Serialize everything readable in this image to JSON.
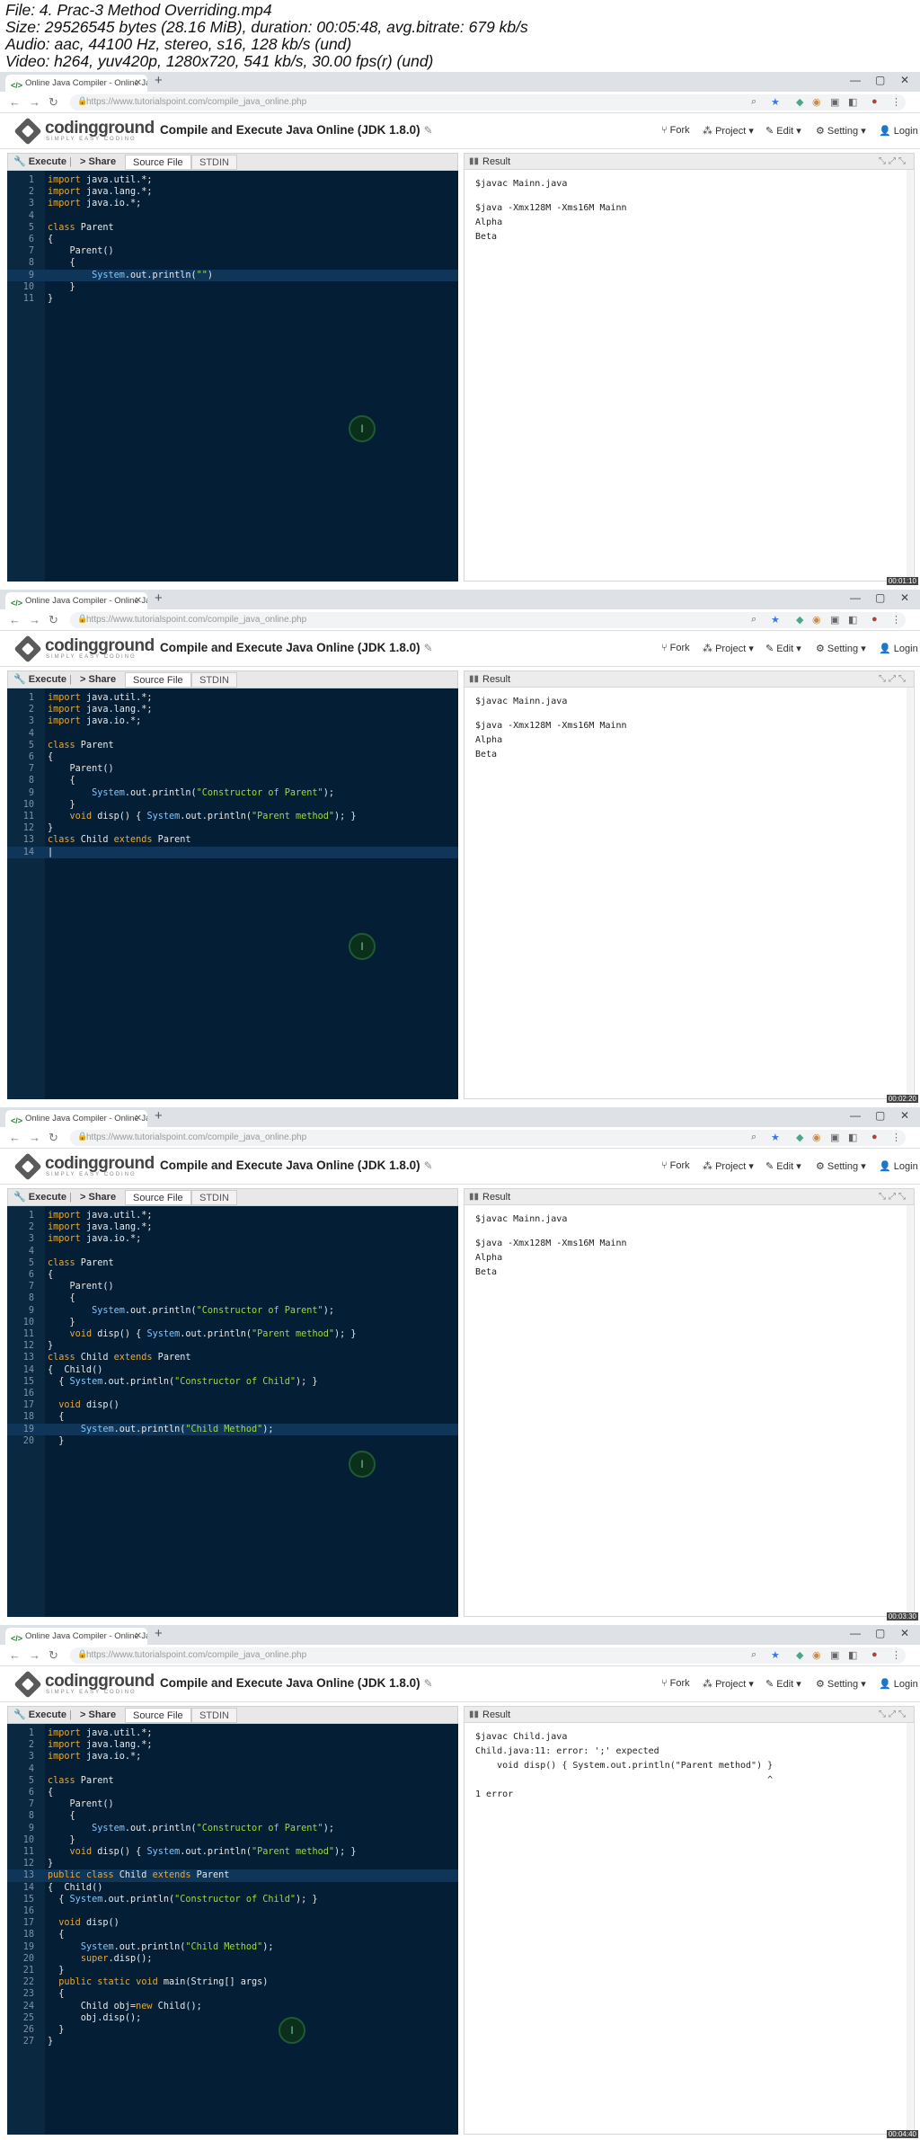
{
  "header": {
    "lines": [
      "File: 4. Prac-3 Method Overriding.mp4",
      "Size: 29526545 bytes (28.16 MiB), duration: 00:05:48, avg.bitrate: 679 kb/s",
      "Audio: aac, 44100 Hz, stereo, s16, 128 kb/s (und)",
      "Video: h264, yuv420p, 1280x720, 541 kb/s, 30.00 fps(r) (und)"
    ]
  },
  "browser": {
    "tab_title": "Online Java Compiler - Online Ja",
    "url_domain": "https://www.tutorialspoint.com",
    "url_path": "/compile_java_online.php"
  },
  "site": {
    "logo_name": "codingground",
    "logo_tagline": "SIMPLY EASY CODING",
    "page_title": "Compile and Execute Java Online (JDK 1.8.0)",
    "menu": [
      "Fork",
      "Project",
      "Edit",
      "Setting",
      "Login"
    ]
  },
  "toolbar": {
    "execute": "Execute",
    "share": "Share",
    "source_file": "Source File",
    "stdin": "STDIN"
  },
  "result_label": "Result",
  "colors": {
    "editor_bg": "#031e35",
    "keyword": "#e6a93b",
    "string": "#9fdb3c"
  },
  "frames": [
    {
      "timestamp": "00:01:10",
      "highlight_line": 9,
      "cursor_line": null,
      "cursor_mark_line": 15.5,
      "code": [
        [
          [
            "import",
            "kw"
          ],
          [
            " java.util.*;",
            ""
          ]
        ],
        [
          [
            "import",
            "kw"
          ],
          [
            " java.lang.*;",
            ""
          ]
        ],
        [
          [
            "import",
            "kw"
          ],
          [
            " java.io.*;",
            ""
          ]
        ],
        [],
        [
          [
            "class",
            "kw"
          ],
          [
            " Parent",
            ""
          ]
        ],
        [
          [
            "{",
            ""
          ]
        ],
        [
          [
            "    Parent()",
            ""
          ]
        ],
        [
          [
            "    {",
            ""
          ]
        ],
        [
          [
            "        ",
            ""
          ],
          [
            "System",
            "typ"
          ],
          [
            ".out.println(",
            ""
          ],
          [
            "\"\"",
            "str"
          ],
          [
            ")",
            ""
          ]
        ],
        [
          [
            "    }",
            ""
          ]
        ],
        [
          [
            "}",
            ""
          ]
        ]
      ],
      "output": [
        "$javac Mainn.java",
        "",
        "$java -Xmx128M -Xms16M Mainn",
        "Alpha",
        "Beta"
      ]
    },
    {
      "timestamp": "00:02:20",
      "highlight_line": 14,
      "cursor_line": 14,
      "cursor_mark_line": 15.5,
      "code": [
        [
          [
            "import",
            "kw"
          ],
          [
            " java.util.*;",
            ""
          ]
        ],
        [
          [
            "import",
            "kw"
          ],
          [
            " java.lang.*;",
            ""
          ]
        ],
        [
          [
            "import",
            "kw"
          ],
          [
            " java.io.*;",
            ""
          ]
        ],
        [],
        [
          [
            "class",
            "kw"
          ],
          [
            " Parent",
            ""
          ]
        ],
        [
          [
            "{",
            ""
          ]
        ],
        [
          [
            "    Parent()",
            ""
          ]
        ],
        [
          [
            "    {",
            ""
          ]
        ],
        [
          [
            "        ",
            ""
          ],
          [
            "System",
            "typ"
          ],
          [
            ".out.println(",
            ""
          ],
          [
            "\"Constructor of Parent\"",
            "str"
          ],
          [
            ");",
            ""
          ]
        ],
        [
          [
            "    }",
            ""
          ]
        ],
        [
          [
            "    ",
            ""
          ],
          [
            "void",
            "kw"
          ],
          [
            " disp() { ",
            ""
          ],
          [
            "System",
            "typ"
          ],
          [
            ".out.println(",
            ""
          ],
          [
            "\"Parent method\"",
            "str"
          ],
          [
            "); }",
            ""
          ]
        ],
        [
          [
            "}",
            ""
          ]
        ],
        [
          [
            "class",
            "kw"
          ],
          [
            " Child ",
            ""
          ],
          [
            "extends",
            "kw"
          ],
          [
            " Parent",
            ""
          ]
        ],
        []
      ],
      "output": [
        "$javac Mainn.java",
        "",
        "$java -Xmx128M -Xms16M Mainn",
        "Alpha",
        "Beta"
      ]
    },
    {
      "timestamp": "00:03:30",
      "highlight_line": 19,
      "cursor_line": null,
      "cursor_mark_line": 15.5,
      "code": [
        [
          [
            "import",
            "kw"
          ],
          [
            " java.util.*;",
            ""
          ]
        ],
        [
          [
            "import",
            "kw"
          ],
          [
            " java.lang.*;",
            ""
          ]
        ],
        [
          [
            "import",
            "kw"
          ],
          [
            " java.io.*;",
            ""
          ]
        ],
        [],
        [
          [
            "class",
            "kw"
          ],
          [
            " Parent",
            ""
          ]
        ],
        [
          [
            "{",
            ""
          ]
        ],
        [
          [
            "    Parent()",
            ""
          ]
        ],
        [
          [
            "    {",
            ""
          ]
        ],
        [
          [
            "        ",
            ""
          ],
          [
            "System",
            "typ"
          ],
          [
            ".out.println(",
            ""
          ],
          [
            "\"Constructor of Parent\"",
            "str"
          ],
          [
            ");",
            ""
          ]
        ],
        [
          [
            "    }",
            ""
          ]
        ],
        [
          [
            "    ",
            ""
          ],
          [
            "void",
            "kw"
          ],
          [
            " disp() { ",
            ""
          ],
          [
            "System",
            "typ"
          ],
          [
            ".out.println(",
            ""
          ],
          [
            "\"Parent method\"",
            "str"
          ],
          [
            "); }",
            ""
          ]
        ],
        [
          [
            "}",
            ""
          ]
        ],
        [
          [
            "class",
            "kw"
          ],
          [
            " Child ",
            ""
          ],
          [
            "extends",
            "kw"
          ],
          [
            " Parent",
            ""
          ]
        ],
        [
          [
            "{  Child()",
            ""
          ]
        ],
        [
          [
            "  { ",
            ""
          ],
          [
            "System",
            "typ"
          ],
          [
            ".out.println(",
            ""
          ],
          [
            "\"Constructor of Child\"",
            "str"
          ],
          [
            "); }",
            ""
          ]
        ],
        [],
        [
          [
            "  ",
            ""
          ],
          [
            "void",
            "kw"
          ],
          [
            " disp()",
            ""
          ]
        ],
        [
          [
            "  {",
            ""
          ]
        ],
        [
          [
            "      ",
            ""
          ],
          [
            "System",
            "typ"
          ],
          [
            ".out.println(",
            ""
          ],
          [
            "\"Child Method\"",
            "str"
          ],
          [
            ");",
            ""
          ]
        ],
        [
          [
            "  }",
            ""
          ]
        ]
      ],
      "output": [
        "$javac Mainn.java",
        "",
        "$java -Xmx128M -Xms16M Mainn",
        "Alpha",
        "Beta"
      ]
    },
    {
      "timestamp": "00:04:40",
      "highlight_line": 13,
      "cursor_line": null,
      "cursor_mark_line": 16,
      "code": [
        [
          [
            "import",
            "kw"
          ],
          [
            " java.util.*;",
            ""
          ]
        ],
        [
          [
            "import",
            "kw"
          ],
          [
            " java.lang.*;",
            ""
          ]
        ],
        [
          [
            "import",
            "kw"
          ],
          [
            " java.io.*;",
            ""
          ]
        ],
        [],
        [
          [
            "class",
            "kw"
          ],
          [
            " Parent",
            ""
          ]
        ],
        [
          [
            "{",
            ""
          ]
        ],
        [
          [
            "    Parent()",
            ""
          ]
        ],
        [
          [
            "    {",
            ""
          ]
        ],
        [
          [
            "        ",
            ""
          ],
          [
            "System",
            "typ"
          ],
          [
            ".out.println(",
            ""
          ],
          [
            "\"Constructor of Parent\"",
            "str"
          ],
          [
            ");",
            ""
          ]
        ],
        [
          [
            "    }",
            ""
          ]
        ],
        [
          [
            "    ",
            ""
          ],
          [
            "void",
            "kw"
          ],
          [
            " disp() { ",
            ""
          ],
          [
            "System",
            "typ"
          ],
          [
            ".out.println(",
            ""
          ],
          [
            "\"Parent method\"",
            "str"
          ],
          [
            "); }",
            ""
          ]
        ],
        [
          [
            "}",
            ""
          ]
        ],
        [
          [
            "public",
            "kw"
          ],
          [
            " ",
            ""
          ],
          [
            "class",
            "kw"
          ],
          [
            " Child ",
            ""
          ],
          [
            "extends",
            "kw"
          ],
          [
            " Parent",
            ""
          ]
        ],
        [
          [
            "{  Child()",
            ""
          ]
        ],
        [
          [
            "  { ",
            ""
          ],
          [
            "System",
            "typ"
          ],
          [
            ".out.println(",
            ""
          ],
          [
            "\"Constructor of Child\"",
            "str"
          ],
          [
            "); }",
            ""
          ]
        ],
        [],
        [
          [
            "  ",
            ""
          ],
          [
            "void",
            "kw"
          ],
          [
            " disp()",
            ""
          ]
        ],
        [
          [
            "  {",
            ""
          ]
        ],
        [
          [
            "      ",
            ""
          ],
          [
            "System",
            "typ"
          ],
          [
            ".out.println(",
            ""
          ],
          [
            "\"Child Method\"",
            "str"
          ],
          [
            ");",
            ""
          ]
        ],
        [
          [
            "      ",
            ""
          ],
          [
            "super",
            "kw"
          ],
          [
            ".disp();",
            ""
          ]
        ],
        [
          [
            "  }",
            ""
          ]
        ],
        [
          [
            "  ",
            ""
          ],
          [
            "public",
            "kw"
          ],
          [
            " ",
            ""
          ],
          [
            "static",
            "kw"
          ],
          [
            " ",
            ""
          ],
          [
            "void",
            "kw"
          ],
          [
            " main(String[] args)",
            ""
          ]
        ],
        [
          [
            "  {",
            ""
          ]
        ],
        [
          [
            "      Child obj=",
            ""
          ],
          [
            "new",
            "kw"
          ],
          [
            " Child();",
            ""
          ]
        ],
        [
          [
            "      obj.disp();",
            ""
          ]
        ],
        [
          [
            "  }",
            ""
          ]
        ],
        [
          [
            "}",
            ""
          ]
        ]
      ],
      "output": [
        "$javac Child.java",
        "Child.java:11: error: ';' expected",
        "    void disp() { System.out.println(\"Parent method\") }",
        "                                                      ^",
        "1 error"
      ]
    }
  ]
}
